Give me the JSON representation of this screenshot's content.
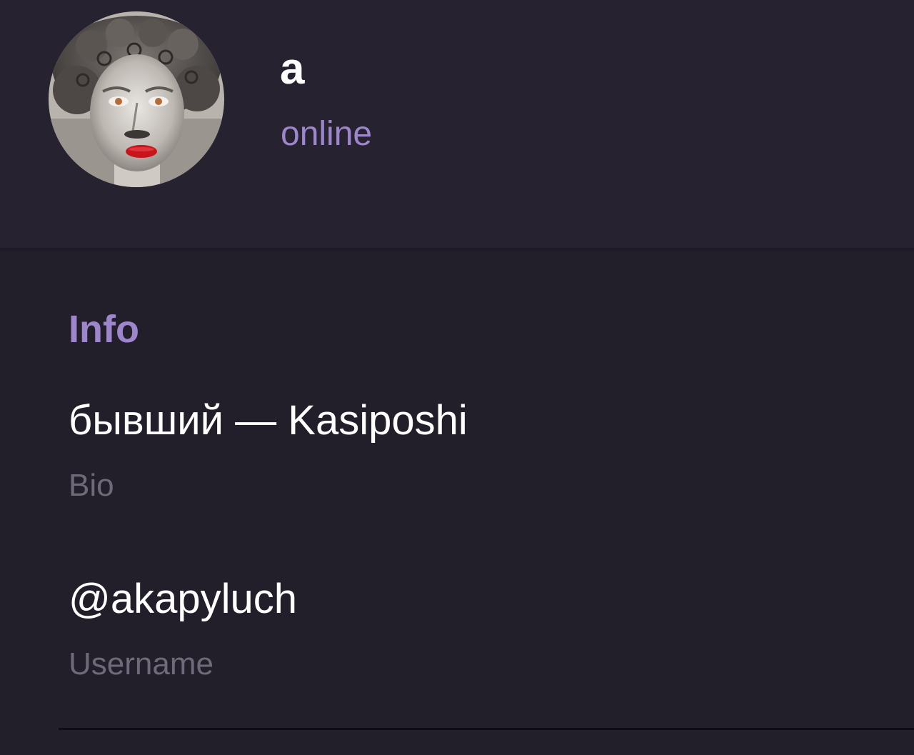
{
  "profile": {
    "avatar_icon": "profile-photo-statue-icon",
    "name": "a",
    "status": "online",
    "status_color": "#9d86cc"
  },
  "info": {
    "title": "Info",
    "bio": {
      "value": "бывший — Kasiposhi",
      "label": "Bio"
    },
    "username": {
      "value": "@akapyluch",
      "label": "Username"
    }
  },
  "colors": {
    "header_bg": "#27222f",
    "page_bg": "#221e2a",
    "accent": "#9d86cc",
    "secondary_text": "#6f6a79"
  }
}
